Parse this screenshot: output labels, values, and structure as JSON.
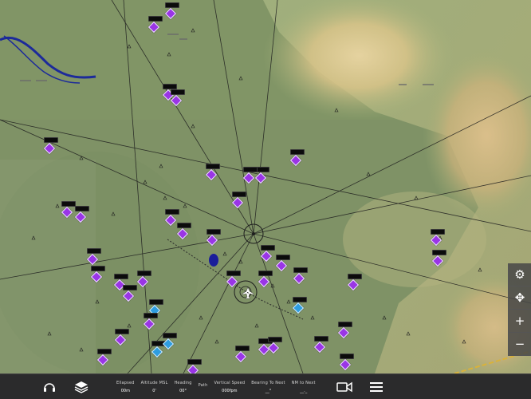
{
  "map": {
    "background": "#7f9266",
    "highlight_color": "#a977d6",
    "route_color": "#1e1e1e"
  },
  "waypoints": [
    {
      "label": "",
      "color": "purple"
    },
    {
      "label": "",
      "color": "purple"
    },
    {
      "label": "",
      "color": "purple"
    },
    {
      "label": "",
      "color": "purple"
    },
    {
      "label": "",
      "color": "purple"
    },
    {
      "label": "",
      "color": "purple"
    },
    {
      "label": "",
      "color": "purple"
    },
    {
      "label": "",
      "color": "purple"
    },
    {
      "label": "",
      "color": "purple"
    },
    {
      "label": "",
      "color": "purple"
    },
    {
      "label": "",
      "color": "purple"
    },
    {
      "label": "",
      "color": "purple"
    },
    {
      "label": "",
      "color": "purple"
    },
    {
      "label": "",
      "color": "purple"
    },
    {
      "label": "",
      "color": "purple"
    },
    {
      "label": "",
      "color": "blue"
    },
    {
      "label": "",
      "color": "blue"
    }
  ],
  "right_tools": [
    {
      "name": "settings-gear-icon",
      "glyph": "⚙"
    },
    {
      "name": "recenter-icon",
      "glyph": "✥"
    },
    {
      "name": "zoom-in-button",
      "glyph": "+"
    },
    {
      "name": "zoom-out-button",
      "glyph": "−"
    }
  ],
  "bottom_bar": {
    "icons": [
      "headset-icon",
      "layers-icon"
    ],
    "stats": [
      {
        "label": "Ellapsed",
        "value": "00m"
      },
      {
        "label": "Altitude MSL",
        "value": "0'"
      },
      {
        "label": "Heading",
        "value": "00°"
      },
      {
        "label": "Path",
        "value": ""
      },
      {
        "label": "Vertical Speed",
        "value": "000fpm"
      },
      {
        "label": "Bearing To Next",
        "value": "__°"
      },
      {
        "label": "NM to Next",
        "value": "__._"
      }
    ],
    "right_icons": [
      "video-camera-icon",
      "menu-icon"
    ]
  }
}
